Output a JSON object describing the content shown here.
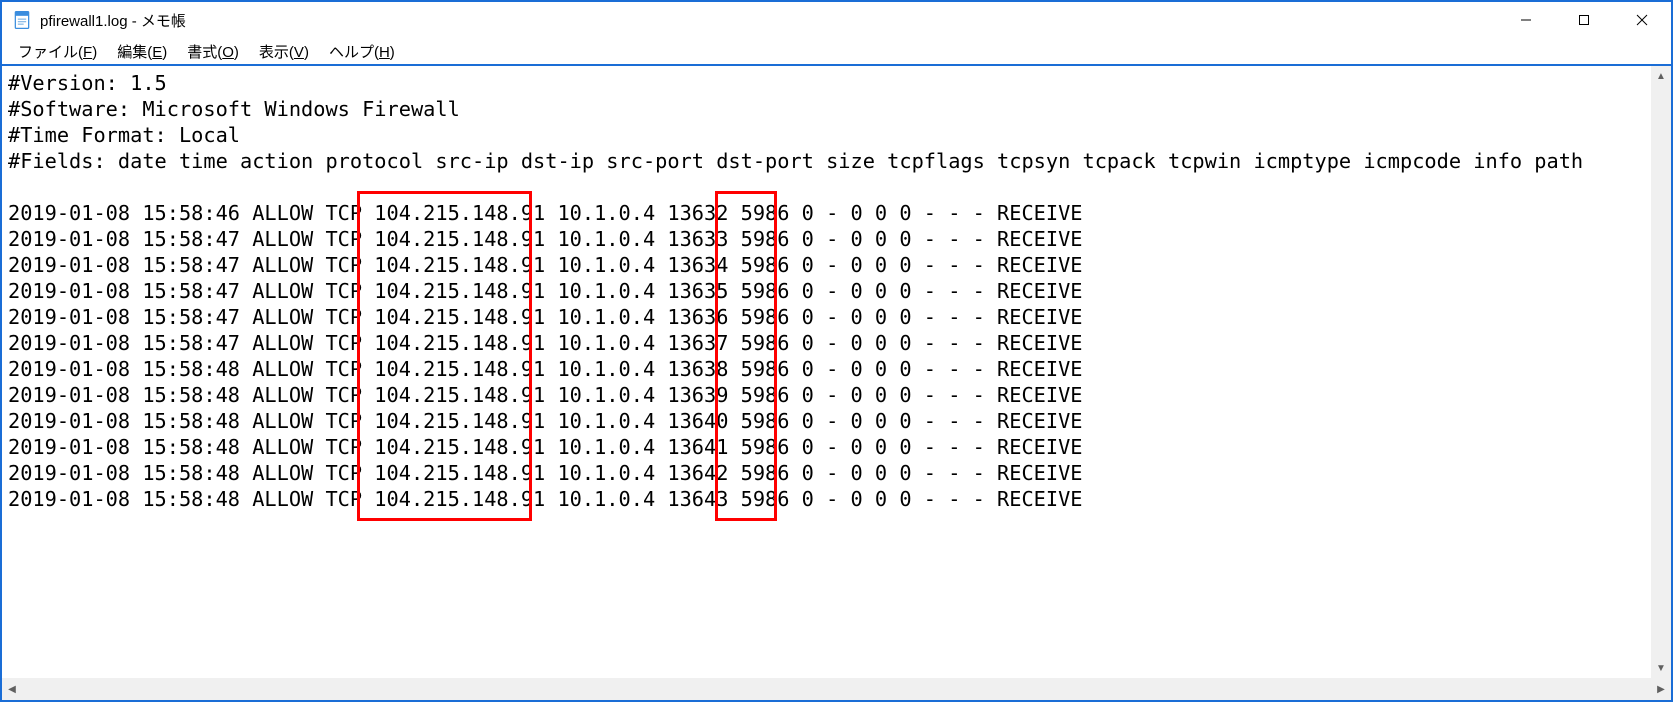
{
  "window": {
    "title": "pfirewall1.log - メモ帳"
  },
  "menu": {
    "file": {
      "label": "ファイル",
      "accel": "F"
    },
    "edit": {
      "label": "編集",
      "accel": "E"
    },
    "format": {
      "label": "書式",
      "accel": "O"
    },
    "view": {
      "label": "表示",
      "accel": "V"
    },
    "help": {
      "label": "ヘルプ",
      "accel": "H"
    }
  },
  "header": {
    "version": "#Version: 1.5",
    "software": "#Software: Microsoft Windows Firewall",
    "timeformat": "#Time Format: Local",
    "fields": "#Fields: date time action protocol src-ip dst-ip src-port dst-port size tcpflags tcpsyn tcpack tcpwin icmptype icmpcode info path"
  },
  "log_rows": [
    {
      "date": "2019-01-08",
      "time": "15:58:46",
      "action": "ALLOW",
      "protocol": "TCP",
      "src_ip": "104.215.148.91",
      "dst_ip": "10.1.0.4",
      "src_port": "13632",
      "dst_port": "5986",
      "rest": "0 - 0 0 0 - - - RECEIVE"
    },
    {
      "date": "2019-01-08",
      "time": "15:58:47",
      "action": "ALLOW",
      "protocol": "TCP",
      "src_ip": "104.215.148.91",
      "dst_ip": "10.1.0.4",
      "src_port": "13633",
      "dst_port": "5986",
      "rest": "0 - 0 0 0 - - - RECEIVE"
    },
    {
      "date": "2019-01-08",
      "time": "15:58:47",
      "action": "ALLOW",
      "protocol": "TCP",
      "src_ip": "104.215.148.91",
      "dst_ip": "10.1.0.4",
      "src_port": "13634",
      "dst_port": "5986",
      "rest": "0 - 0 0 0 - - - RECEIVE"
    },
    {
      "date": "2019-01-08",
      "time": "15:58:47",
      "action": "ALLOW",
      "protocol": "TCP",
      "src_ip": "104.215.148.91",
      "dst_ip": "10.1.0.4",
      "src_port": "13635",
      "dst_port": "5986",
      "rest": "0 - 0 0 0 - - - RECEIVE"
    },
    {
      "date": "2019-01-08",
      "time": "15:58:47",
      "action": "ALLOW",
      "protocol": "TCP",
      "src_ip": "104.215.148.91",
      "dst_ip": "10.1.0.4",
      "src_port": "13636",
      "dst_port": "5986",
      "rest": "0 - 0 0 0 - - - RECEIVE"
    },
    {
      "date": "2019-01-08",
      "time": "15:58:47",
      "action": "ALLOW",
      "protocol": "TCP",
      "src_ip": "104.215.148.91",
      "dst_ip": "10.1.0.4",
      "src_port": "13637",
      "dst_port": "5986",
      "rest": "0 - 0 0 0 - - - RECEIVE"
    },
    {
      "date": "2019-01-08",
      "time": "15:58:48",
      "action": "ALLOW",
      "protocol": "TCP",
      "src_ip": "104.215.148.91",
      "dst_ip": "10.1.0.4",
      "src_port": "13638",
      "dst_port": "5986",
      "rest": "0 - 0 0 0 - - - RECEIVE"
    },
    {
      "date": "2019-01-08",
      "time": "15:58:48",
      "action": "ALLOW",
      "protocol": "TCP",
      "src_ip": "104.215.148.91",
      "dst_ip": "10.1.0.4",
      "src_port": "13639",
      "dst_port": "5986",
      "rest": "0 - 0 0 0 - - - RECEIVE"
    },
    {
      "date": "2019-01-08",
      "time": "15:58:48",
      "action": "ALLOW",
      "protocol": "TCP",
      "src_ip": "104.215.148.91",
      "dst_ip": "10.1.0.4",
      "src_port": "13640",
      "dst_port": "5986",
      "rest": "0 - 0 0 0 - - - RECEIVE"
    },
    {
      "date": "2019-01-08",
      "time": "15:58:48",
      "action": "ALLOW",
      "protocol": "TCP",
      "src_ip": "104.215.148.91",
      "dst_ip": "10.1.0.4",
      "src_port": "13641",
      "dst_port": "5986",
      "rest": "0 - 0 0 0 - - - RECEIVE"
    },
    {
      "date": "2019-01-08",
      "time": "15:58:48",
      "action": "ALLOW",
      "protocol": "TCP",
      "src_ip": "104.215.148.91",
      "dst_ip": "10.1.0.4",
      "src_port": "13642",
      "dst_port": "5986",
      "rest": "0 - 0 0 0 - - - RECEIVE"
    },
    {
      "date": "2019-01-08",
      "time": "15:58:48",
      "action": "ALLOW",
      "protocol": "TCP",
      "src_ip": "104.215.148.91",
      "dst_ip": "10.1.0.4",
      "src_port": "13643",
      "dst_port": "5986",
      "rest": "0 - 0 0 0 - - - RECEIVE"
    }
  ]
}
